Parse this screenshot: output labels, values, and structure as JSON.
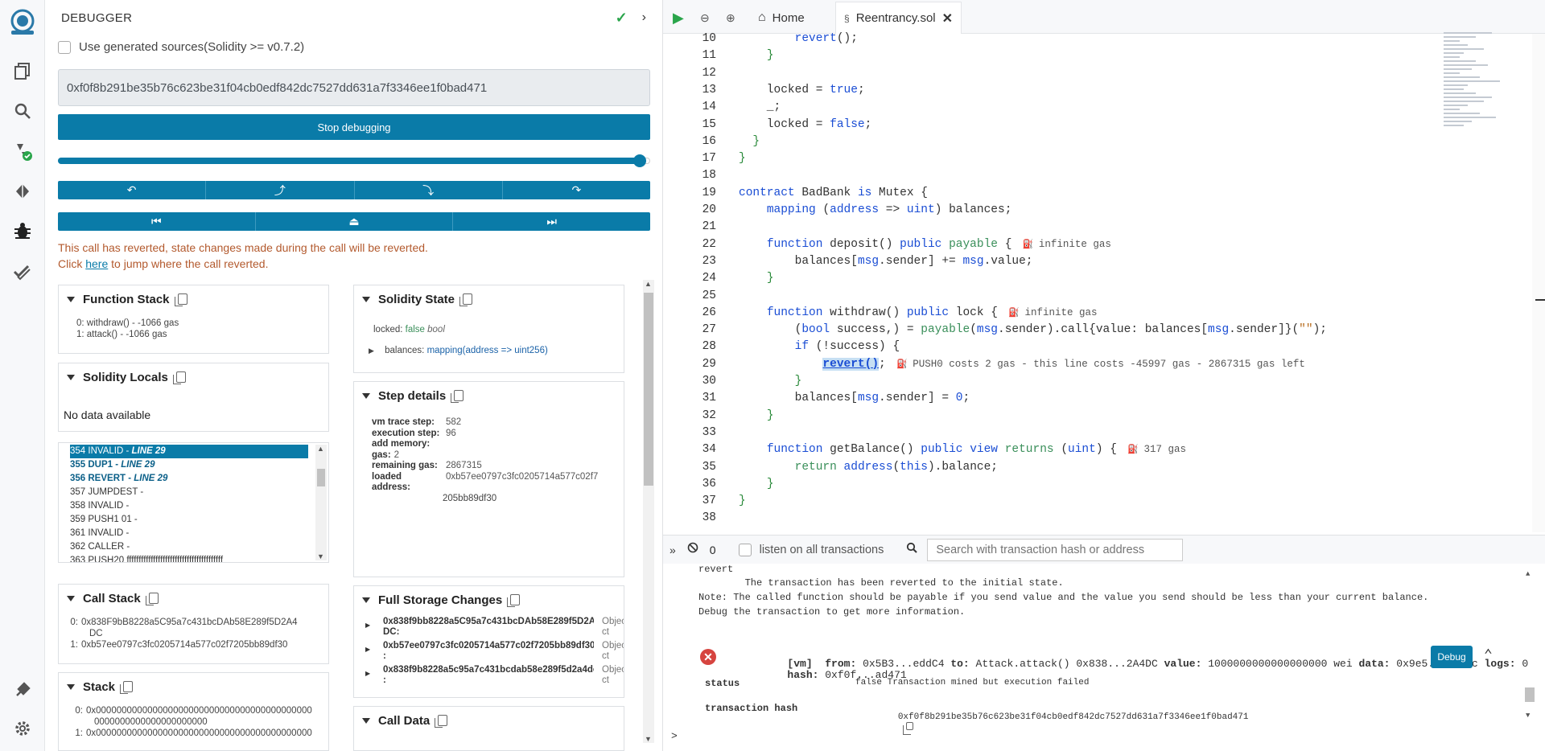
{
  "colors": {
    "accent": "#0a7ba8",
    "error_text": "#b35a2e",
    "keyword": "#1a4dd4",
    "type": "#3a8f5a"
  },
  "rail": {
    "items": [
      "remix-logo-icon",
      "file-explorer-icon",
      "search-icon",
      "compiler-icon",
      "deploy-icon",
      "debugger-icon",
      "tests-icon",
      "plugin-manager-icon",
      "settings-icon"
    ]
  },
  "debugger": {
    "title": "DEBUGGER",
    "use_generated_sources_label": "Use generated sources(Solidity >= v0.7.2)",
    "tx_hash": "0xf0f8b291be35b76c623be31f04cb0edf842dc7527dd631a7f3346ee1f0bad471",
    "stop_label": "Stop debugging",
    "slider_fraction": 0.982,
    "revert_line1": "This call has reverted, state changes made during the call will be reverted.",
    "revert_line2_pre": "Click",
    "revert_link": "here",
    "revert_line2_post": "to jump where the call reverted.",
    "function_stack": {
      "title": "Function Stack",
      "items": [
        "0: withdraw() - -1066 gas",
        "1: attack() - -1066 gas"
      ]
    },
    "solidity_locals": {
      "title": "Solidity Locals",
      "empty": "No data available"
    },
    "opcodes": [
      {
        "text": "354 INVALID - ",
        "line": "LINE 29",
        "state": "selected"
      },
      {
        "text": "355 DUP1 - ",
        "line": "LINE 29",
        "state": "highlight"
      },
      {
        "text": "356 REVERT - ",
        "line": "LINE 29",
        "state": "highlight"
      },
      {
        "text": "357 JUMPDEST -",
        "line": "",
        "state": "normal"
      },
      {
        "text": "358 INVALID -",
        "line": "",
        "state": "normal"
      },
      {
        "text": "359 PUSH1 01 -",
        "line": "",
        "state": "normal"
      },
      {
        "text": "361 INVALID -",
        "line": "",
        "state": "normal"
      },
      {
        "text": "362 CALLER -",
        "line": "",
        "state": "normal"
      },
      {
        "text": "363 PUSH20 ffffffffffffffffffffffffffffffffffffffff",
        "line": "",
        "state": "normal"
      }
    ],
    "call_stack": {
      "title": "Call Stack",
      "items": [
        {
          "idx": "0:",
          "val": "0x838F9bB8228a5C95a7c431bcDAb58E289f5D2A4",
          "cont": "DC"
        },
        {
          "idx": "1:",
          "val": "0xb57ee0797c3fc0205714a577c02f7205bb89df30",
          "cont": ""
        }
      ]
    },
    "stack": {
      "title": "Stack",
      "items": [
        {
          "idx": "0:",
          "val": "0x000000000000000000000000000000000000000000",
          "cont": "0000000000000000000000"
        },
        {
          "idx": "1:",
          "val": "0x000000000000000000000000000000000000000000",
          "cont": ""
        }
      ]
    },
    "solidity_state": {
      "title": "Solidity State",
      "locked_label": "locked:",
      "locked_value": "false",
      "locked_type": "bool",
      "balances_label": "balances:",
      "balances_value": "mapping(address => uint256)"
    },
    "step_details": {
      "title": "Step details",
      "rows": [
        {
          "k": "vm trace step:",
          "v": "582"
        },
        {
          "k": "execution step:",
          "v": "96"
        },
        {
          "k": "add memory:",
          "v": ""
        },
        {
          "k": "gas:",
          "v": "2"
        },
        {
          "k": "remaining gas:",
          "v": "2867315"
        },
        {
          "k": "loaded address:",
          "v": "0xb57ee0797c3fc0205714a577c02f7"
        }
      ],
      "loaded_cont": "205bb89df30"
    },
    "full_storage": {
      "title": "Full Storage Changes",
      "items": [
        {
          "addr": "0x838f9bb8228a5C95a7c431bcDAb58E289f5D2A4",
          "tail": "DC:",
          "type": "Objec",
          "type2": "ct"
        },
        {
          "addr": "0xb57ee0797c3fc0205714a577c02f7205bb89df30",
          "tail": ":",
          "type": "Objec",
          "type2": "ct"
        },
        {
          "addr": "0x838f9b8228a5c95a7c431bcdab58e289f5d2a4dc",
          "tail": ":",
          "type": "Objec",
          "type2": "ct"
        }
      ]
    },
    "call_data": {
      "title": "Call Data"
    }
  },
  "editor": {
    "home_tab": "Home",
    "file_tab": "Reentrancy.sol",
    "lines": [
      {
        "n": "10",
        "html": "        <span class=\"kw\">revert</span>();"
      },
      {
        "n": "11",
        "html": "    <span class=\"brace\">}</span>"
      },
      {
        "n": "12",
        "html": ""
      },
      {
        "n": "13",
        "html": "    locked = <span class=\"kw\">true</span>;"
      },
      {
        "n": "14",
        "html": "    _;"
      },
      {
        "n": "15",
        "html": "    locked = <span class=\"kw\">false</span>;"
      },
      {
        "n": "16",
        "html": "  <span class=\"brace\">}</span>"
      },
      {
        "n": "17",
        "html": "<span class=\"brace\">}</span>"
      },
      {
        "n": "18",
        "html": ""
      },
      {
        "n": "19",
        "html": "<span class=\"kw\">contract</span> BadBank <span class=\"kw\">is</span> Mutex {"
      },
      {
        "n": "20",
        "html": "    <span class=\"kw\">mapping</span> (<span class=\"kw\">address</span> => <span class=\"kw\">uint</span>) balances;"
      },
      {
        "n": "21",
        "html": ""
      },
      {
        "n": "22",
        "html": "    <span class=\"kw\">function</span> deposit() <span class=\"kw\">public</span> <span class=\"ty\">payable</span> {"
      },
      {
        "n": "23",
        "html": "        balances[<span class=\"kw\">msg</span>.sender] += <span class=\"kw\">msg</span>.value;"
      },
      {
        "n": "24",
        "html": "    <span class=\"brace\">}</span>"
      },
      {
        "n": "25",
        "html": ""
      },
      {
        "n": "26",
        "html": "    <span class=\"kw\">function</span> withdraw() <span class=\"kw\">public</span> lock {"
      },
      {
        "n": "27",
        "html": "        (<span class=\"kw\">bool</span> success,) = <span class=\"ty\">payable</span>(<span class=\"kw\">msg</span>.sender).call{value: balances[<span class=\"kw\">msg</span>.sender]}(<span class=\"str\">\"\"</span>);"
      },
      {
        "n": "28",
        "html": "        <span class=\"kw\">if</span> (!success) {"
      },
      {
        "n": "29",
        "html": "            <span class=\"kw\" style=\"background:#c6dff3;font-weight:bold;text-decoration:underline;\">revert()</span>;"
      },
      {
        "n": "30",
        "html": "        <span class=\"brace\">}</span>"
      },
      {
        "n": "31",
        "html": "        balances[<span class=\"kw\">msg</span>.sender] = <span class=\"kw\">0</span>;"
      },
      {
        "n": "32",
        "html": "    <span class=\"brace\">}</span>"
      },
      {
        "n": "33",
        "html": ""
      },
      {
        "n": "34",
        "html": "    <span class=\"kw\">function</span> getBalance() <span class=\"kw\">public</span> <span class=\"kw\">view</span> <span class=\"ty\">returns</span> (<span class=\"kw\">uint</span>) {"
      },
      {
        "n": "35",
        "html": "        <span class=\"ty\">return</span> <span class=\"kw\">address</span>(<span class=\"kw\">this</span>).balance;"
      },
      {
        "n": "36",
        "html": "    <span class=\"brace\">}</span>"
      },
      {
        "n": "37",
        "html": "<span class=\"brace\">}</span>"
      },
      {
        "n": "38",
        "html": ""
      }
    ],
    "gas_hints": [
      {
        "line": "22",
        "text": "infinite gas"
      },
      {
        "line": "26",
        "text": "infinite gas"
      },
      {
        "line": "29",
        "text": "PUSH0 costs 2 gas - this line costs -45997 gas - 2867315 gas left"
      },
      {
        "line": "34",
        "text": "317 gas"
      }
    ]
  },
  "terminal": {
    "count": "0",
    "listen_label": "listen on all transactions",
    "search_placeholder": "Search with transaction hash or address",
    "lines": {
      "l1": "revert",
      "l2": "        The transaction has been reverted to the initial state.",
      "l3": "Note: The called function should be payable if you send value and the value you send should be less than your current balance.",
      "l4": "Debug the transaction to get more information."
    },
    "tx": {
      "vm": "[vm]",
      "from_label": "from:",
      "from": "0x5B3...eddC4",
      "to_label": "to:",
      "to": "Attack.attack() 0x838...2A4DC",
      "value_label": "value:",
      "value": "1000000000000000000 wei",
      "data_label": "data:",
      "data": "0x9e5...faafc",
      "logs_label": "logs:",
      "logs": "0",
      "hash_label": "hash:",
      "hash": "0xf0f...ad471",
      "debug_label": "Debug"
    },
    "status_label": "status",
    "status_value": "false Transaction mined but execution failed",
    "tx_hash_label": "transaction hash",
    "tx_hash_value": "0xf0f8b291be35b76c623be31f04cb0edf842dc7527dd631a7f3346ee1f0bad471",
    "prompt": ">"
  }
}
